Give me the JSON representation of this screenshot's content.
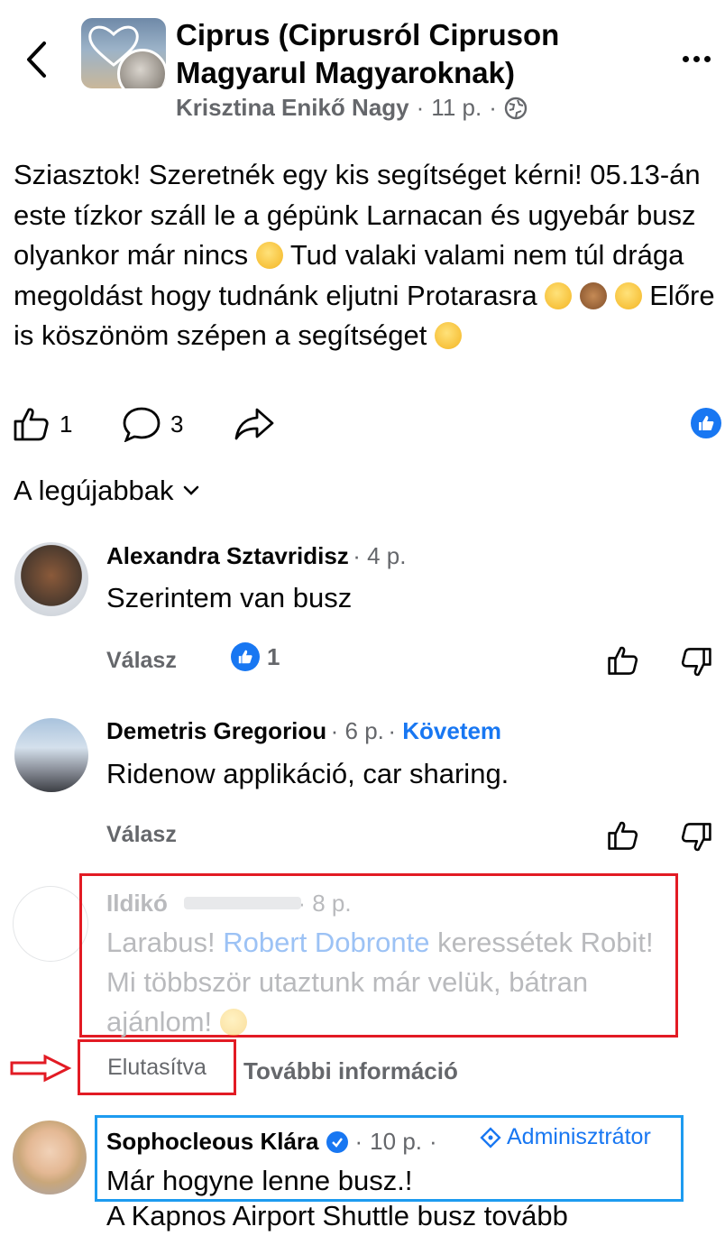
{
  "header": {
    "group_name": "Ciprus (Ciprusról Cipruson Magyarul Magyaroknak)",
    "author": "Krisztina Enikő Nagy",
    "time": "11 p.",
    "separator": "·"
  },
  "post": {
    "text_part1": "Sziasztok! Szeretnék egy kis segítséget kérni! 05.13-án este tízkor száll le a gépünk Larnacan és ugyebár busz olyankor már nincs",
    "text_part2": "Tud valaki valami nem túl drága megoldást hogy tudnánk eljutni Protarasra",
    "text_part3": "Előre is köszönöm szépen a segítséget",
    "like_count": "1",
    "comment_count": "3"
  },
  "sort": {
    "label": "A legújabbak"
  },
  "comments": [
    {
      "name": "Alexandra Sztavridisz",
      "time": "4 p.",
      "text": "Szerintem van busz",
      "reply": "Válasz",
      "reactions": "1"
    },
    {
      "name": "Demetris Gregoriou",
      "time": "6 p.",
      "follow": "Követem",
      "text": "Ridenow applikáció, car sharing.",
      "reply": "Válasz"
    },
    {
      "name": "Ildikó",
      "time": "8 p.",
      "text_before": "Larabus!",
      "mention": "Robert Dobronte",
      "text_after": "keressétek Robit! Mi többször utaztunk már velük, bátran ajánlom!",
      "status": "Elutasítva",
      "more_info": "További információ"
    },
    {
      "name": "Sophocleous Klára",
      "time": "10 p.",
      "role": "Adminisztrátor",
      "text": "Már hogyne lenne busz.!",
      "text_cut": "A Kapnos Airport Shuttle busz tovább"
    }
  ],
  "colors": {
    "accent": "#1877f2",
    "annotation_red": "#e21b24",
    "annotation_blue": "#1d9bf0",
    "secondary_text": "#65676b"
  }
}
